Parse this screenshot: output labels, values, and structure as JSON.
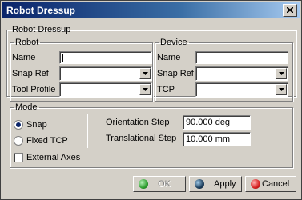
{
  "window": {
    "title": "Robot Dressup"
  },
  "dressup_group": {
    "legend": "Robot Dressup"
  },
  "robot": {
    "legend": "Robot",
    "name_label": "Name",
    "name_value": "",
    "snap_ref_label": "Snap Ref",
    "snap_ref_value": "",
    "tool_profile_label": "Tool Profile",
    "tool_profile_value": ""
  },
  "device": {
    "legend": "Device",
    "name_label": "Name",
    "name_value": "",
    "snap_ref_label": "Snap Ref",
    "snap_ref_value": "",
    "tcp_label": "TCP",
    "tcp_value": ""
  },
  "mode": {
    "legend": "Mode",
    "snap_label": "Snap",
    "snap_selected": true,
    "fixed_tcp_label": "Fixed TCP",
    "fixed_tcp_selected": false,
    "orientation_step_label": "Orientation Step",
    "orientation_step_value": "90.000 deg",
    "translational_step_label": "Translational Step",
    "translational_step_value": "10.000 mm",
    "external_axes_label": "External Axes",
    "external_axes_checked": false
  },
  "buttons": {
    "ok_label": "OK",
    "ok_enabled": false,
    "apply_label": "Apply",
    "cancel_label": "Cancel"
  },
  "colors": {
    "title_bar": "#0a246a",
    "ok_icon": "#2e9e2e",
    "apply_icon": "#1a3c5a",
    "cancel_icon": "#d62020"
  }
}
